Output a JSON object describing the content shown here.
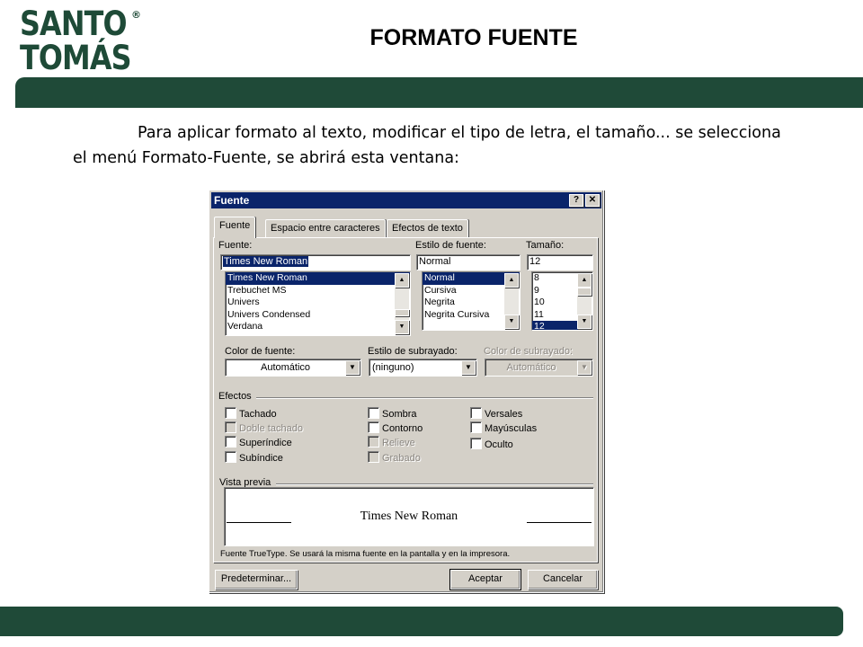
{
  "logo": {
    "line1": "SANTO",
    "line2": "TOMÁS",
    "mark": "®"
  },
  "slide": {
    "title": "FORMATO FUENTE",
    "intro": "Para aplicar formato al texto, modificar el tipo de letra, el tamaño... se selecciona el menú Formato-Fuente, se abrirá esta ventana:"
  },
  "colors": {
    "brand_green": "#1f4a38",
    "title_bar": "#0a246a",
    "dialog_face": "#d4d0c8"
  },
  "dialog": {
    "title": "Fuente",
    "help_label": "?",
    "close_label": "✕",
    "tabs": [
      {
        "label": "Fuente"
      },
      {
        "label": "Espacio entre caracteres"
      },
      {
        "label": "Efectos de texto"
      }
    ],
    "font": {
      "label": "Fuente:",
      "value": "Times New Roman",
      "items": [
        "Times New Roman",
        "Trebuchet MS",
        "Univers",
        "Univers Condensed",
        "Verdana"
      ],
      "selected_index": 0
    },
    "style": {
      "label": "Estilo de fuente:",
      "value": "Normal",
      "items": [
        "Normal",
        "Cursiva",
        "Negrita",
        "Negrita Cursiva"
      ],
      "selected_index": 0
    },
    "size": {
      "label": "Tamaño:",
      "value": "12",
      "items": [
        "8",
        "9",
        "10",
        "11",
        "12"
      ],
      "selected_index": 4
    },
    "font_color": {
      "label": "Color de fuente:",
      "value": "Automático"
    },
    "underline_style": {
      "label": "Estilo de subrayado:",
      "value": "(ninguno)"
    },
    "underline_color": {
      "label": "Color de subrayado:",
      "value": "Automático"
    },
    "effects": {
      "label": "Efectos",
      "col1": [
        {
          "label": "Tachado",
          "enabled": true
        },
        {
          "label": "Doble tachado",
          "enabled": false
        },
        {
          "label": "Superíndice",
          "enabled": true
        },
        {
          "label": "Subíndice",
          "enabled": true
        }
      ],
      "col2": [
        {
          "label": "Sombra",
          "enabled": true
        },
        {
          "label": "Contorno",
          "enabled": true
        },
        {
          "label": "Relieve",
          "enabled": false
        },
        {
          "label": "Grabado",
          "enabled": false
        }
      ],
      "col3": [
        {
          "label": "Versales",
          "enabled": true
        },
        {
          "label": "Mayúsculas",
          "enabled": true
        },
        {
          "label": "Oculto",
          "enabled": true
        }
      ]
    },
    "preview": {
      "label": "Vista previa",
      "sample": "Times New Roman",
      "note": "Fuente TrueType. Se usará la misma fuente en la pantalla y en la impresora."
    },
    "buttons": {
      "default_label": "Predeterminar...",
      "ok_label": "Aceptar",
      "cancel_label": "Cancelar"
    }
  }
}
